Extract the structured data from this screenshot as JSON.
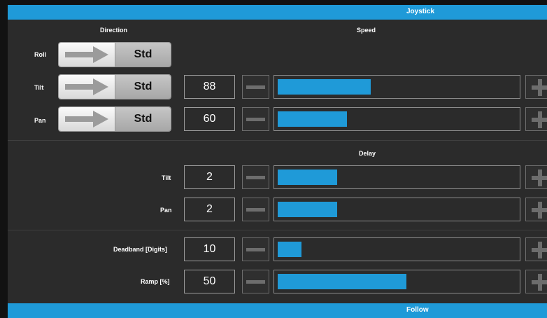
{
  "header": {
    "title": "Joystick"
  },
  "columns": {
    "direction": "Direction",
    "speed": "Speed",
    "delay": "Delay"
  },
  "direction": {
    "std_label": "Std",
    "rows": [
      {
        "label": "Roll"
      },
      {
        "label": "Tilt"
      },
      {
        "label": "Pan"
      }
    ]
  },
  "speed": {
    "rows": [
      {
        "label": "Tilt",
        "value": "88",
        "level_percent": 39
      },
      {
        "label": "Pan",
        "value": "60",
        "level_percent": 29
      }
    ]
  },
  "delay": {
    "rows": [
      {
        "label": "Tilt",
        "value": "2",
        "level_percent": 25
      },
      {
        "label": "Pan",
        "value": "2",
        "level_percent": 25
      }
    ]
  },
  "other": {
    "rows": [
      {
        "label": "Deadband [Digits]",
        "value": "10",
        "level_percent": 10
      },
      {
        "label": "Ramp [%]",
        "value": "50",
        "level_percent": 54
      }
    ]
  },
  "footer": {
    "title": "Follow"
  },
  "colors": {
    "accent": "#1f9ad8",
    "panel": "#2b2b2b",
    "control_gray": "#6d6d6d"
  },
  "icons": {
    "minus": "minus-icon",
    "plus": "plus-icon",
    "arrow": "arrow-right-icon"
  }
}
